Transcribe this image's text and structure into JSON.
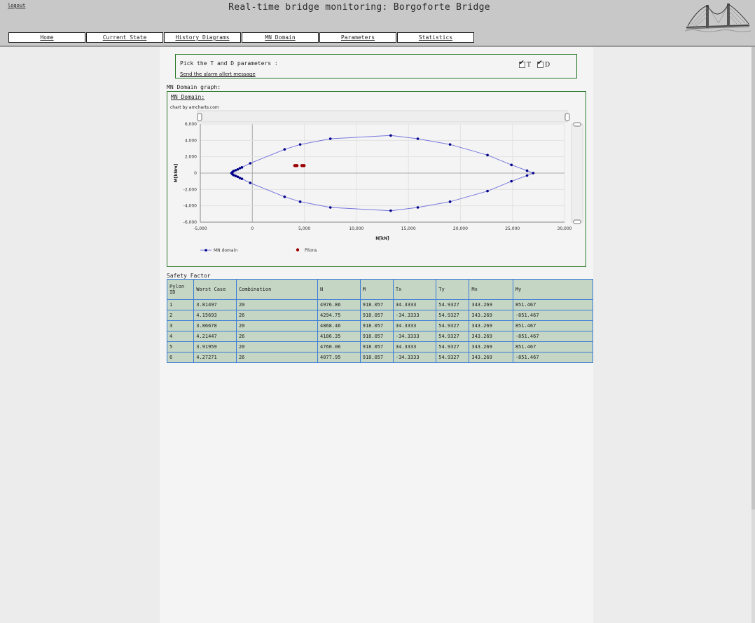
{
  "header": {
    "logout": "logout",
    "title": "Real-time bridge monitoring: Borgoforte Bridge",
    "logo_icon": "bridge-logo-icon"
  },
  "nav": [
    "Home",
    "Current State",
    "History Diagrams",
    "MN Domain",
    "Parameters",
    "Statistics"
  ],
  "params": {
    "prompt": "Pick the T and D parameters :",
    "alarm_link": "Send the alarm allert message",
    "checkboxes": [
      {
        "label": "T",
        "checked": true
      },
      {
        "label": "D",
        "checked": true
      }
    ]
  },
  "graph_section_title": "MN Domain graph:",
  "graph": {
    "title": "MN Domain:",
    "credit": "chart by amcharts.com"
  },
  "chart_data": {
    "type": "scatter",
    "xlabel": "N[kN]",
    "ylabel": "M[kNm]",
    "xlim": [
      -5000,
      30000
    ],
    "ylim": [
      -6000,
      6000
    ],
    "x_ticks": [
      "-5,000",
      "0",
      "5,000",
      "10,000",
      "15,000",
      "20,000",
      "25,000",
      "30,000"
    ],
    "y_ticks": [
      "6,000",
      "4,000",
      "2,000",
      "0",
      "-2,000",
      "-4,000",
      "-6,000"
    ],
    "grid": true,
    "legend_position": "bottom-left",
    "series": [
      {
        "name": "MN domain",
        "color": "#00008b",
        "line_color": "#7777dd",
        "marker": "line-with-dots",
        "points": [
          [
            -2000,
            0
          ],
          [
            -1900,
            150
          ],
          [
            -1800,
            250
          ],
          [
            -1600,
            350
          ],
          [
            -1400,
            450
          ],
          [
            -1200,
            600
          ],
          [
            -1000,
            700
          ],
          [
            -200,
            1200
          ],
          [
            3100,
            2900
          ],
          [
            4600,
            3500
          ],
          [
            7500,
            4200
          ],
          [
            13300,
            4600
          ],
          [
            15900,
            4200
          ],
          [
            19000,
            3500
          ],
          [
            22600,
            2200
          ],
          [
            24900,
            1000
          ],
          [
            26400,
            300
          ],
          [
            27000,
            0
          ],
          [
            26400,
            -300
          ],
          [
            24900,
            -1000
          ],
          [
            22600,
            -2200
          ],
          [
            19000,
            -3500
          ],
          [
            15900,
            -4200
          ],
          [
            13300,
            -4600
          ],
          [
            7500,
            -4200
          ],
          [
            4600,
            -3500
          ],
          [
            3100,
            -2900
          ],
          [
            -200,
            -1200
          ],
          [
            -1000,
            -700
          ],
          [
            -1200,
            -600
          ],
          [
            -1400,
            -450
          ],
          [
            -1600,
            -350
          ],
          [
            -1800,
            -250
          ],
          [
            -1900,
            -150
          ],
          [
            -2000,
            0
          ]
        ]
      },
      {
        "name": "Pilons",
        "color": "#990000",
        "marker": "dot",
        "points": [
          [
            4077.95,
            918.057
          ],
          [
            4186.35,
            918.057
          ],
          [
            4294.75,
            918.057
          ],
          [
            4760.06,
            918.057
          ],
          [
            4868.46,
            918.057
          ],
          [
            4976.86,
            918.057
          ]
        ]
      }
    ]
  },
  "safety": {
    "title": "Safety Factor",
    "columns": [
      "Pylon ID",
      "Worst Case",
      "Combination",
      "N",
      "M",
      "Tx",
      "Ty",
      "Mx",
      "My"
    ],
    "rows": [
      [
        "1",
        "3.81497",
        "20",
        "4976.86",
        "918.057",
        "34.3333",
        "54.9327",
        "343.269",
        "851.467"
      ],
      [
        "2",
        "4.15693",
        "26",
        "4294.75",
        "918.057",
        "-34.3333",
        "54.9327",
        "343.269",
        "-851.467"
      ],
      [
        "3",
        "3.86678",
        "20",
        "4868.46",
        "918.057",
        "34.3333",
        "54.9327",
        "343.269",
        "851.467"
      ],
      [
        "4",
        "4.21447",
        "26",
        "4186.35",
        "918.057",
        "-34.3333",
        "54.9327",
        "343.269",
        "-851.467"
      ],
      [
        "5",
        "3.91959",
        "20",
        "4760.06",
        "918.057",
        "34.3333",
        "54.9327",
        "343.269",
        "851.467"
      ],
      [
        "6",
        "4.27271",
        "26",
        "4077.95",
        "918.057",
        "-34.3333",
        "54.9327",
        "343.269",
        "-851.467"
      ]
    ]
  }
}
